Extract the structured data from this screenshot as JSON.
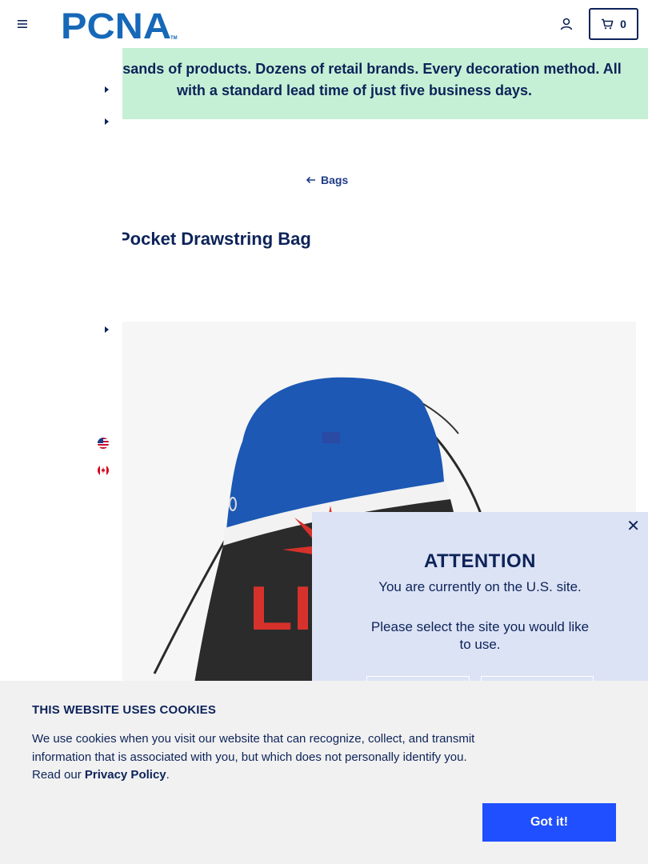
{
  "header": {
    "logo_text": "PCNA",
    "logo_tm": "TM",
    "cart_count": "0"
  },
  "banner": {
    "text": "Thousands of products. Dozens of retail brands. Every decoration method. All with a standard lead time of just five business days."
  },
  "breadcrumb": {
    "back_label": "Bags"
  },
  "product": {
    "title": "Pocket Drawstring Bag",
    "imprint_text": "LIG"
  },
  "modal": {
    "title": "ATTENTION",
    "line1": "You are currently on the U.S. site.",
    "line2": "Please select the site you would like to use.",
    "close_glyph": "✕"
  },
  "cookie": {
    "title": "THIS WEBSITE USES COOKIES",
    "text": "We use cookies when you visit our website that can recognize, collect, and transmit information that is associated with you, but which does not personally identify you. Read our",
    "link": "Privacy Policy",
    "text_end": ".",
    "button": "Got it!"
  },
  "colors": {
    "navy": "#0d2359",
    "brand_blue": "#1668b8",
    "banner_green": "#c6f0d5",
    "modal_bg": "#dce3f5",
    "button_blue": "#1f4fff"
  },
  "icons": [
    "menu-icon",
    "account-icon",
    "cart-icon",
    "arrow-left-icon",
    "chevron-right-icon",
    "us-flag-icon",
    "canada-flag-icon",
    "close-icon"
  ]
}
